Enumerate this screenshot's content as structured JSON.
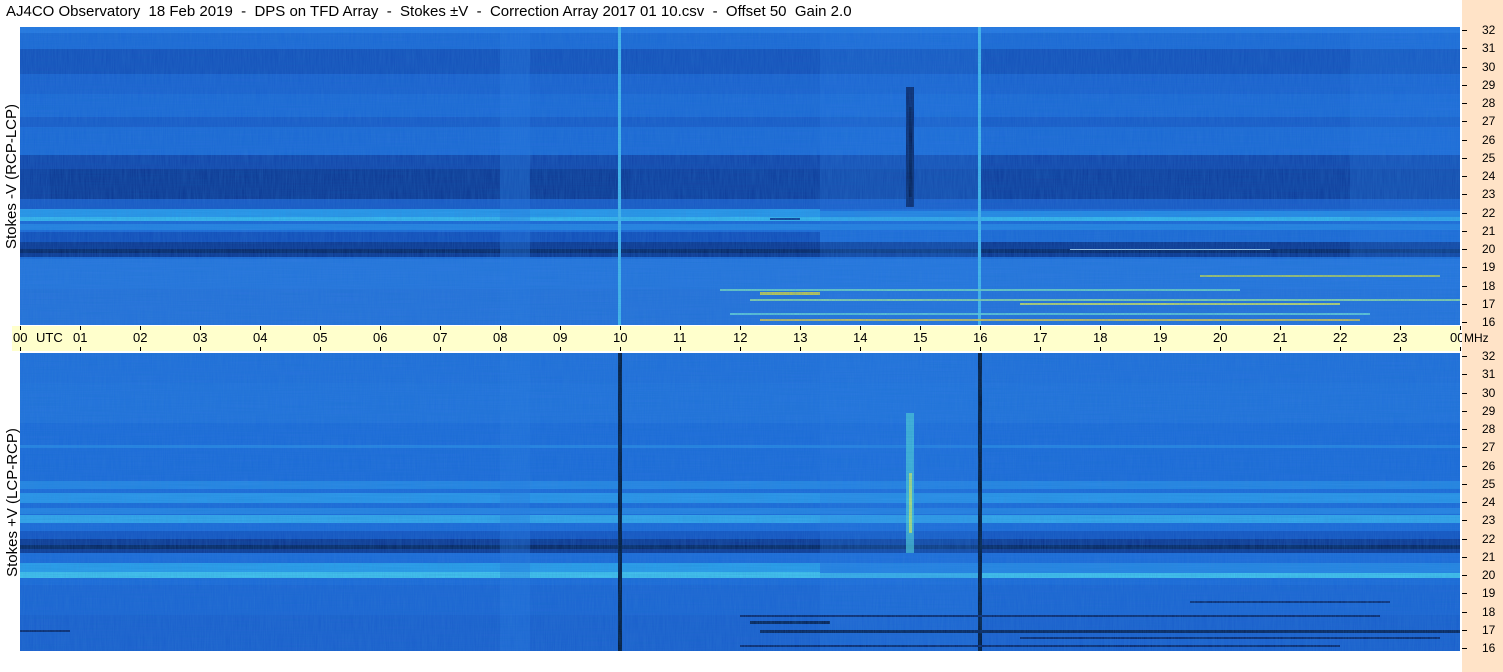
{
  "title": "AJ4CO Observatory  18 Feb 2019  -  DPS on TFD Array  -  Stokes ±V  -  Correction Array 2017 01 10.csv  -  Offset 50  Gain 2.0",
  "panels": [
    {
      "id": "top",
      "ylabel": "Stokes -V (RCP-LCP)"
    },
    {
      "id": "bottom",
      "ylabel": "Stokes +V (LCP-RCP)"
    }
  ],
  "time_axis": {
    "labels": [
      "00",
      "UTC",
      "01",
      "02",
      "03",
      "04",
      "05",
      "06",
      "07",
      "08",
      "09",
      "10",
      "11",
      "12",
      "13",
      "14",
      "15",
      "16",
      "17",
      "18",
      "19",
      "20",
      "21",
      "22",
      "23",
      "00"
    ],
    "unit": "MHz"
  },
  "freq_axis": {
    "labels": [
      "32",
      "31",
      "30",
      "29",
      "28",
      "27",
      "26",
      "25",
      "24",
      "23",
      "22",
      "21",
      "20",
      "19",
      "18",
      "17",
      "16"
    ]
  },
  "colors": {
    "background": "#ffffff",
    "timebar": "#ffffcc",
    "right_strip": "#ffe3c7",
    "spectrogram_base": "#1c5fd6"
  }
}
